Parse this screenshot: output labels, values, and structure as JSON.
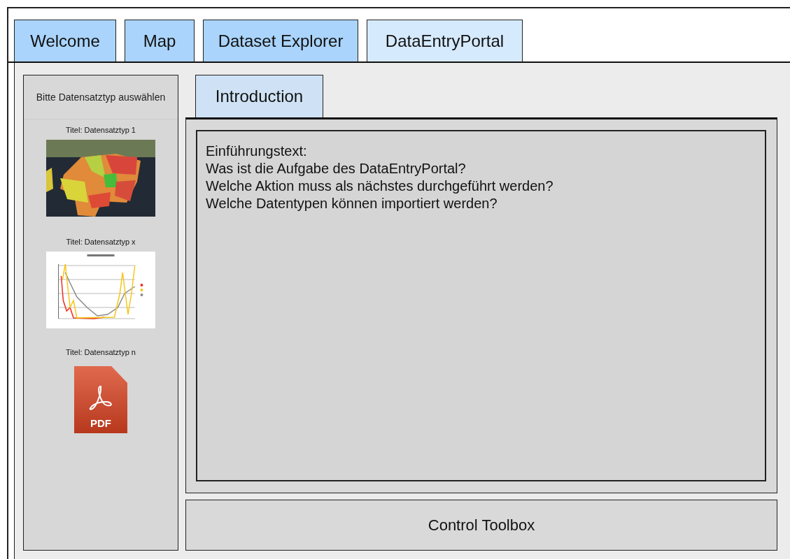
{
  "tabs": [
    {
      "label": "Welcome",
      "selected": false
    },
    {
      "label": "Map",
      "selected": false
    },
    {
      "label": "Dataset Explorer",
      "selected": false
    },
    {
      "label": "DataEntryPortal",
      "selected": true
    }
  ],
  "sidebar": {
    "header": "Bitte Datensatztyp auswählen",
    "items": [
      {
        "title": "Titel: Datensatztyp 1",
        "kind": "map"
      },
      {
        "title": "Titel: Datensatztyp x",
        "kind": "chart"
      },
      {
        "title": "Titel: Datensatztyp n",
        "kind": "pdf",
        "icon_label": "PDF"
      }
    ]
  },
  "content_tabs": [
    {
      "label": "Introduction",
      "selected": true
    }
  ],
  "introduction": {
    "lines": [
      "Einführungstext:",
      "Was ist die Aufgabe des DataEntryPortal?",
      "Welche Aktion muss als nächstes durchgeführt werden?",
      "Welche Datentypen können importiert werden?"
    ]
  },
  "toolbox": {
    "label": "Control Toolbox"
  }
}
